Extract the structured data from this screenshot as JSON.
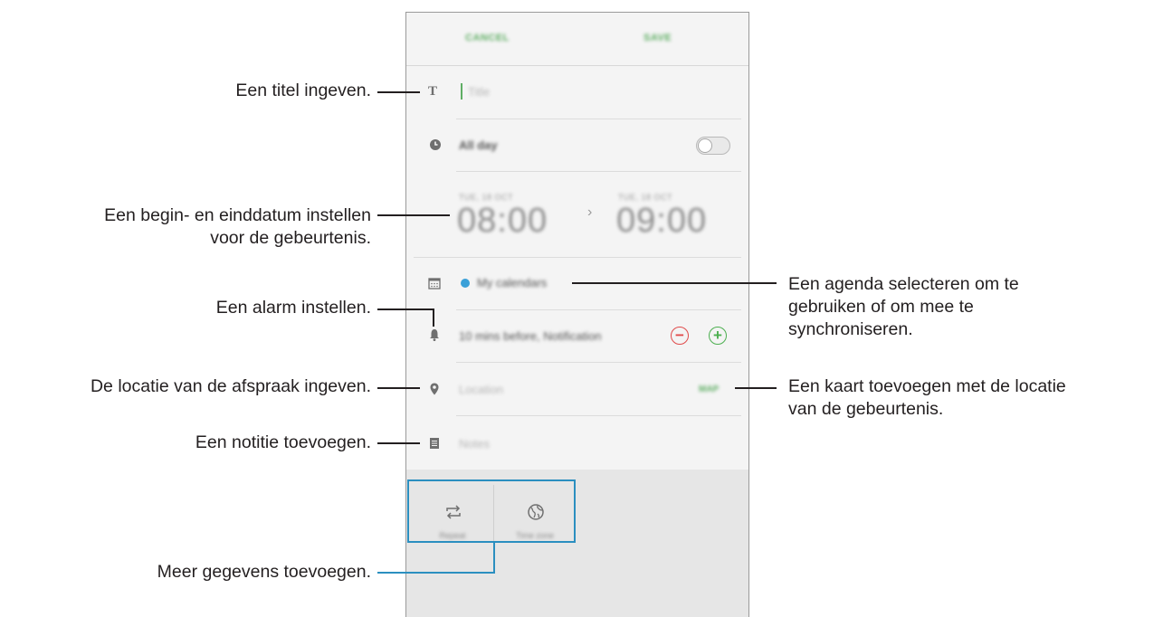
{
  "app": {
    "cancel_label": "CANCEL",
    "save_label": "SAVE",
    "title_placeholder": "Title",
    "all_day_label": "All day",
    "start": {
      "date": "TUE, 18 OCT",
      "time": "08:00"
    },
    "end": {
      "date": "TUE, 18 OCT",
      "time": "09:00"
    },
    "calendar_label": "My calendars",
    "alarm_label": "10 mins before, Notification",
    "location_placeholder": "Location",
    "map_label": "MAP",
    "notes_placeholder": "Notes",
    "extras": [
      {
        "label": "Repeat",
        "icon": "repeat-icon"
      },
      {
        "label": "Time zone",
        "icon": "globe-icon"
      }
    ]
  },
  "callouts": {
    "title": "Een titel ingeven.",
    "dates_line1": "Een begin- en einddatum instellen",
    "dates_line2": "voor de gebeurtenis.",
    "alarm": "Een alarm instellen.",
    "location": "De locatie van de afspraak ingeven.",
    "note": "Een notitie toevoegen.",
    "more": "Meer gegevens toevoegen.",
    "calendar_line1": "Een agenda selecteren om te",
    "calendar_line2": "gebruiken of om mee te",
    "calendar_line3": "synchroniseren.",
    "map_line1": "Een kaart toevoegen met de locatie",
    "map_line2": "van de gebeurtenis."
  },
  "colors": {
    "accent_green": "#5fae64",
    "callout_blue": "#2b8fc0",
    "calendar_dot": "#3aa0d8",
    "minus_red": "#e04b4b",
    "plus_green": "#4caf50"
  }
}
